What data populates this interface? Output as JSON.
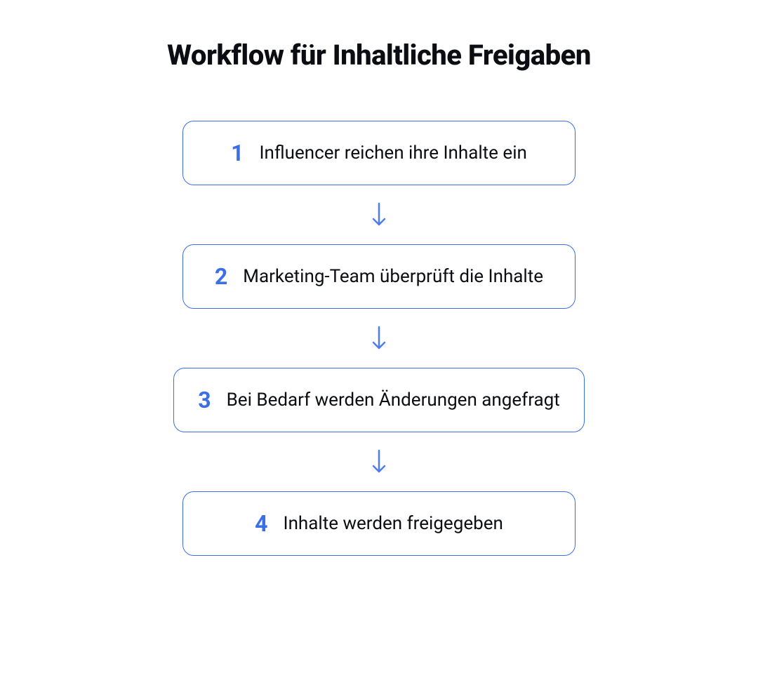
{
  "title": "Workflow für Inhaltliche Freigaben",
  "accent_color": "#3b6fe5",
  "steps": [
    {
      "number": "1",
      "label": "Influencer reichen ihre Inhalte ein"
    },
    {
      "number": "2",
      "label": "Marketing-Team überprüft die Inhalte"
    },
    {
      "number": "3",
      "label": "Bei Bedarf werden Änderungen angefragt"
    },
    {
      "number": "4",
      "label": "Inhalte werden freigegeben"
    }
  ]
}
